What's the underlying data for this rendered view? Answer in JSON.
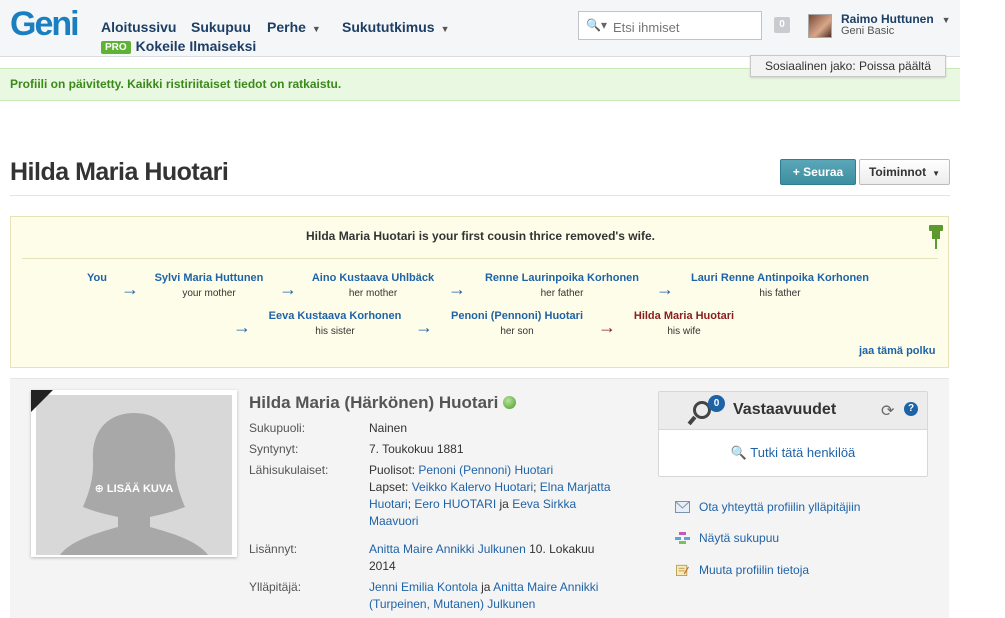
{
  "header": {
    "logo": "Geni",
    "nav": [
      {
        "label": "Aloitussivu",
        "caret": false
      },
      {
        "label": "Sukupuu",
        "caret": false
      },
      {
        "label": "Perhe",
        "caret": true
      },
      {
        "label": "Sukututkimus",
        "caret": true
      }
    ],
    "pro_badge": "PRO",
    "pro_label": "Kokeile Ilmaiseksi",
    "search_placeholder": "Etsi ihmiset",
    "notifications": "0",
    "user_name": "Raimo Huttunen",
    "user_plan": "Geni Basic",
    "social_tooltip": "Sosiaalinen jako: Poissa päältä"
  },
  "banner": {
    "message": "Profiili on päivitetty. Kaikki ristiriitaiset tiedot on ratkaistu."
  },
  "page": {
    "title": "Hilda Maria Huotari",
    "follow_label": "+ Seuraa",
    "actions_label": "Toiminnot"
  },
  "relationship": {
    "headline": "Hilda Maria Huotari is your first cousin thrice removed's wife.",
    "row1": [
      {
        "name": "You",
        "role": ""
      },
      {
        "name": "Sylvi Maria Huttunen",
        "role": "your mother"
      },
      {
        "name": "Aino Kustaava Uhlbäck",
        "role": "her mother"
      },
      {
        "name": "Renne Laurinpoika Korhonen",
        "role": "her father"
      },
      {
        "name": "Lauri Renne Antinpoika Korhonen",
        "role": "his father"
      }
    ],
    "row2": [
      {
        "name": "Eeva Kustaava Korhonen",
        "role": "his sister"
      },
      {
        "name": "Penoni (Pennoni) Huotari",
        "role": "her son"
      },
      {
        "name": "Hilda Maria Huotari",
        "role": "his wife"
      }
    ],
    "arrow": "→",
    "share_link": "jaa tämä polku"
  },
  "profile": {
    "add_photo": "LISÄÄ KUVA",
    "full_name": "Hilda Maria (Härkönen) Huotari",
    "fields": {
      "gender_label": "Sukupuoli:",
      "gender_value": "Nainen",
      "born_label": "Syntynyt:",
      "born_value": "7. Toukokuu 1881",
      "relatives_label": "Lähisukulaiset:",
      "spouses_prefix": "Puolisot:",
      "spouse": "Penoni (Pennoni) Huotari",
      "children_prefix": "Lapset:",
      "child1": "Veikko Kalervo Huotari",
      "child2": "Elna Marjatta Huotari",
      "child3": "Eero HUOTARI",
      "child_and": "ja",
      "child4": "Eeva Sirkka Maavuori",
      "added_label": "Lisännyt:",
      "added_by": "Anitta Maire Annikki Julkunen",
      "added_date": "10. Lokakuu 2014",
      "managers_label": "Ylläpitäjä:",
      "manager1": "Jenni Emilia Kontola",
      "manager_and": "ja",
      "manager2": "Anitta Maire Annikki (Turpeinen, Mutanen) Julkunen"
    }
  },
  "matches": {
    "count": "0",
    "title": "Vastaavuudet",
    "research_link": "Tutki tätä henkilöä"
  },
  "actions": [
    {
      "label": "Ota yhteyttä profiilin ylläpitäjiin",
      "icon": "envelope-icon"
    },
    {
      "label": "Näytä sukupuu",
      "icon": "tree-icon"
    },
    {
      "label": "Muuta profiilin tietoja",
      "icon": "edit-icon"
    }
  ],
  "colors": {
    "link": "#1f63a7",
    "current_person": "#8a1d1d",
    "success_text": "#3a8a1a",
    "follow_button": "#3d8ea1",
    "pro_badge": "#5fb233"
  }
}
